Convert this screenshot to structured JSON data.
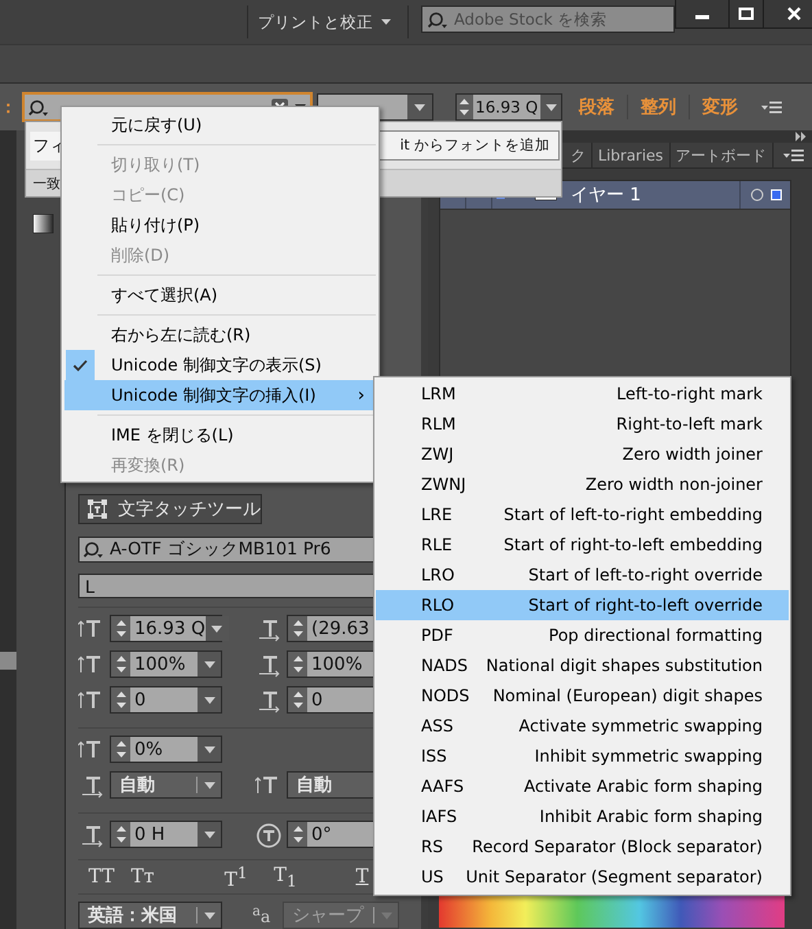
{
  "title_bar": {
    "workspace_menu": "プリントと校正",
    "stock_search": {
      "placeholder": "Adobe Stock を検索"
    }
  },
  "control_bar": {
    "label": "：",
    "font_size": "16.93 Q",
    "links": [
      "段落",
      "整列",
      "変形"
    ]
  },
  "font_popup": {
    "tab": "フィ",
    "match": "一致",
    "add_button": "it からフォントを追加"
  },
  "character_panel": {
    "touch_tool_button": "文字タッチツール",
    "font_family": "A-OTF ゴシックMB101 Pr6",
    "font_style": "L",
    "groups": [
      {
        "rows": [
          {
            "fields": [
              {
                "kind": "spin",
                "value": "16.93 Q",
                "disabled": false
              },
              {
                "kind": "spin",
                "value": "(29.63",
                "disabled": false
              }
            ]
          },
          {
            "fields": [
              {
                "kind": "spin",
                "value": "100%",
                "disabled": false
              },
              {
                "kind": "spin",
                "value": "100%",
                "disabled": false
              }
            ]
          },
          {
            "fields": [
              {
                "kind": "spin",
                "value": "0",
                "disabled": false
              },
              {
                "kind": "spin",
                "value": "0",
                "disabled": false
              }
            ]
          }
        ]
      },
      {
        "rows": [
          {
            "fields": [
              {
                "kind": "spin",
                "value": "0%",
                "disabled": false
              }
            ]
          },
          {
            "fields": [
              {
                "kind": "dropdown",
                "value": "自動",
                "disabled": false
              },
              {
                "kind": "dropdown",
                "value": "自動",
                "disabled": false
              }
            ]
          }
        ]
      },
      {
        "rows": [
          {
            "fields": [
              {
                "kind": "spin",
                "value": "0 H",
                "disabled": false
              },
              {
                "kind": "spin",
                "value": "0°",
                "disabled": false
              }
            ]
          }
        ]
      }
    ],
    "style_buttons": [
      {
        "kind": "all_caps",
        "label": "TT"
      },
      {
        "kind": "small_caps",
        "label": "Tᴛ"
      },
      {
        "kind": "superscript",
        "label": "T$^{1}$"
      },
      {
        "kind": "subscript",
        "label": "T$_{1}$"
      },
      {
        "kind": "underline",
        "label": "T"
      }
    ],
    "language": {
      "kind": "dropdown",
      "value": "英語：米国",
      "disabled": false
    },
    "antialias_label": "$^{a}$a",
    "antialias": {
      "kind": "dropdown",
      "value": "シャープ",
      "disabled": true
    }
  },
  "layers_panel": {
    "tabs": [
      {
        "label": "ク",
        "selected": false
      },
      {
        "label": "Libraries",
        "selected": false
      },
      {
        "label": "アートボード",
        "selected": false
      }
    ],
    "layers": [
      {
        "name": "イヤー 1",
        "selected": true
      }
    ]
  },
  "context_menu": {
    "items": [
      {
        "kind": "item",
        "label": "元に戻す(U)",
        "disabled": false,
        "checked": false,
        "selected": false
      },
      {
        "kind": "separator"
      },
      {
        "kind": "item",
        "label": "切り取り(T)",
        "disabled": true,
        "checked": false,
        "selected": false
      },
      {
        "kind": "item",
        "label": "コピー(C)",
        "disabled": true,
        "checked": false,
        "selected": false
      },
      {
        "kind": "item",
        "label": "貼り付け(P)",
        "disabled": false,
        "checked": false,
        "selected": false
      },
      {
        "kind": "item",
        "label": "削除(D)",
        "disabled": true,
        "checked": false,
        "selected": false
      },
      {
        "kind": "separator"
      },
      {
        "kind": "item",
        "label": "すべて選択(A)",
        "disabled": false,
        "checked": false,
        "selected": false
      },
      {
        "kind": "separator"
      },
      {
        "kind": "item",
        "label": "右から左に読む(R)",
        "disabled": false,
        "checked": false,
        "selected": false
      },
      {
        "kind": "item",
        "label": "Unicode 制御文字の表示(S)",
        "disabled": false,
        "checked": true,
        "selected": false
      },
      {
        "kind": "item",
        "label": "Unicode 制御文字の挿入(I)",
        "disabled": false,
        "checked": false,
        "selected": true,
        "arrow": "›"
      },
      {
        "kind": "separator"
      },
      {
        "kind": "item",
        "label": "IME を閉じる(L)",
        "disabled": false,
        "checked": false,
        "selected": false
      },
      {
        "kind": "item",
        "label": "再変換(R)",
        "disabled": true,
        "checked": false,
        "selected": false
      }
    ]
  },
  "submenu": {
    "items": [
      {
        "code": "LRM",
        "description": "Left-to-right mark",
        "selected": false
      },
      {
        "code": "RLM",
        "description": "Right-to-left mark",
        "selected": false
      },
      {
        "code": "ZWJ",
        "description": "Zero width joiner",
        "selected": false
      },
      {
        "code": "ZWNJ",
        "description": "Zero width non-joiner",
        "selected": false
      },
      {
        "code": "LRE",
        "description": "Start of left-to-right embedding",
        "selected": false
      },
      {
        "code": "RLE",
        "description": "Start of right-to-left embedding",
        "selected": false
      },
      {
        "code": "LRO",
        "description": "Start of left-to-right override",
        "selected": false
      },
      {
        "code": "RLO",
        "description": "Start of right-to-left override",
        "selected": true
      },
      {
        "code": "PDF",
        "description": "Pop directional formatting",
        "selected": false
      },
      {
        "code": "NADS",
        "description": "National digit shapes substitution",
        "selected": false
      },
      {
        "code": "NODS",
        "description": "Nominal (European) digit shapes",
        "selected": false
      },
      {
        "code": "ASS",
        "description": "Activate symmetric swapping",
        "selected": false
      },
      {
        "code": "ISS",
        "description": "Inhibit symmetric swapping",
        "selected": false
      },
      {
        "code": "AAFS",
        "description": "Activate Arabic form shaping",
        "selected": false
      },
      {
        "code": "IAFS",
        "description": "Inhibit Arabic form shaping",
        "selected": false
      },
      {
        "code": "RS",
        "description": "Record Separator (Block separator)",
        "selected": false
      },
      {
        "code": "US",
        "description": "Unit Separator (Segment separator)",
        "selected": false
      }
    ]
  }
}
